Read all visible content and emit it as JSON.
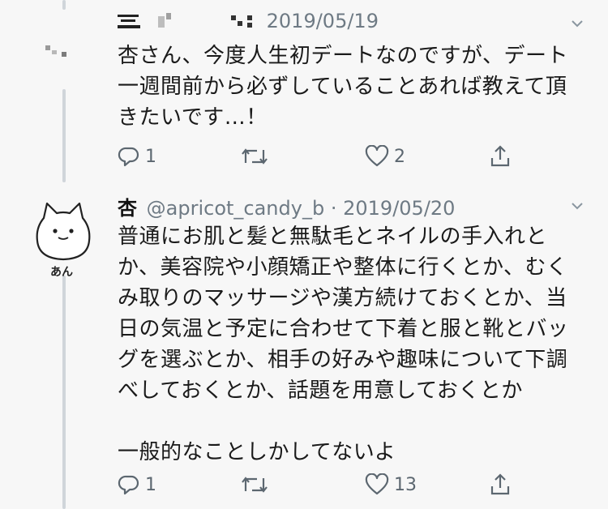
{
  "tweets": [
    {
      "name": "",
      "handle": "",
      "separator": "·",
      "date": "2019/05/19",
      "text": "杏さん、今度人生初デートなのですが、デート\n一週間前から必ずしていることあれば教えて頂\nきたいです…！",
      "replies": "1",
      "retweets": "",
      "likes": "2"
    },
    {
      "name": "杏",
      "handle": "@apricot_candy_b",
      "separator": "·",
      "date": "2019/05/20",
      "avatar_caption": "あん",
      "text": "普通にお肌と髪と無駄毛とネイルの手入れと\nか、美容院や小顔矯正や整体に行くとか、むく\nみ取りのマッサージや漢方続けておくとか、当\n日の気温と予定に合わせて下着と服と靴とバッ\nグを選ぶとか、相手の好みや趣味について下調\nべしておくとか、話題を用意しておくとか\n\n一般的なことしかしてないよ",
      "replies": "1",
      "retweets": "",
      "likes": "13"
    }
  ],
  "icons": {
    "reply": "reply-icon",
    "retweet": "retweet-icon",
    "like": "heart-icon",
    "share": "share-icon",
    "more": "chevron-down-icon"
  },
  "colors": {
    "background": "#f7f7f7",
    "text": "#1a1a1a",
    "secondary": "#6e7a84",
    "thread_line": "#d0d5da"
  }
}
